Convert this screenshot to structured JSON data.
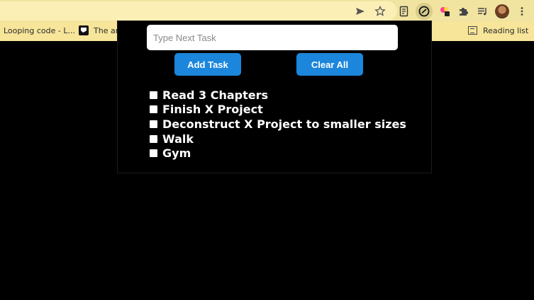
{
  "browser": {
    "bookmarks": [
      {
        "label": "Looping code - L..."
      },
      {
        "label": "The ar"
      }
    ],
    "reading_list_label": "Reading list"
  },
  "extension_popup": {
    "task_input": {
      "placeholder": "Type Next Task",
      "value": ""
    },
    "add_button_label": "Add Task",
    "clear_button_label": "Clear All",
    "tasks": [
      {
        "label": "Read 3 Chapters",
        "checked": false
      },
      {
        "label": "Finish X Project",
        "checked": false
      },
      {
        "label": "Deconstruct X Project to smaller sizes",
        "checked": false
      },
      {
        "label": "Walk",
        "checked": false
      },
      {
        "label": "Gym",
        "checked": false
      }
    ],
    "accent_color": "#1b86dc"
  }
}
